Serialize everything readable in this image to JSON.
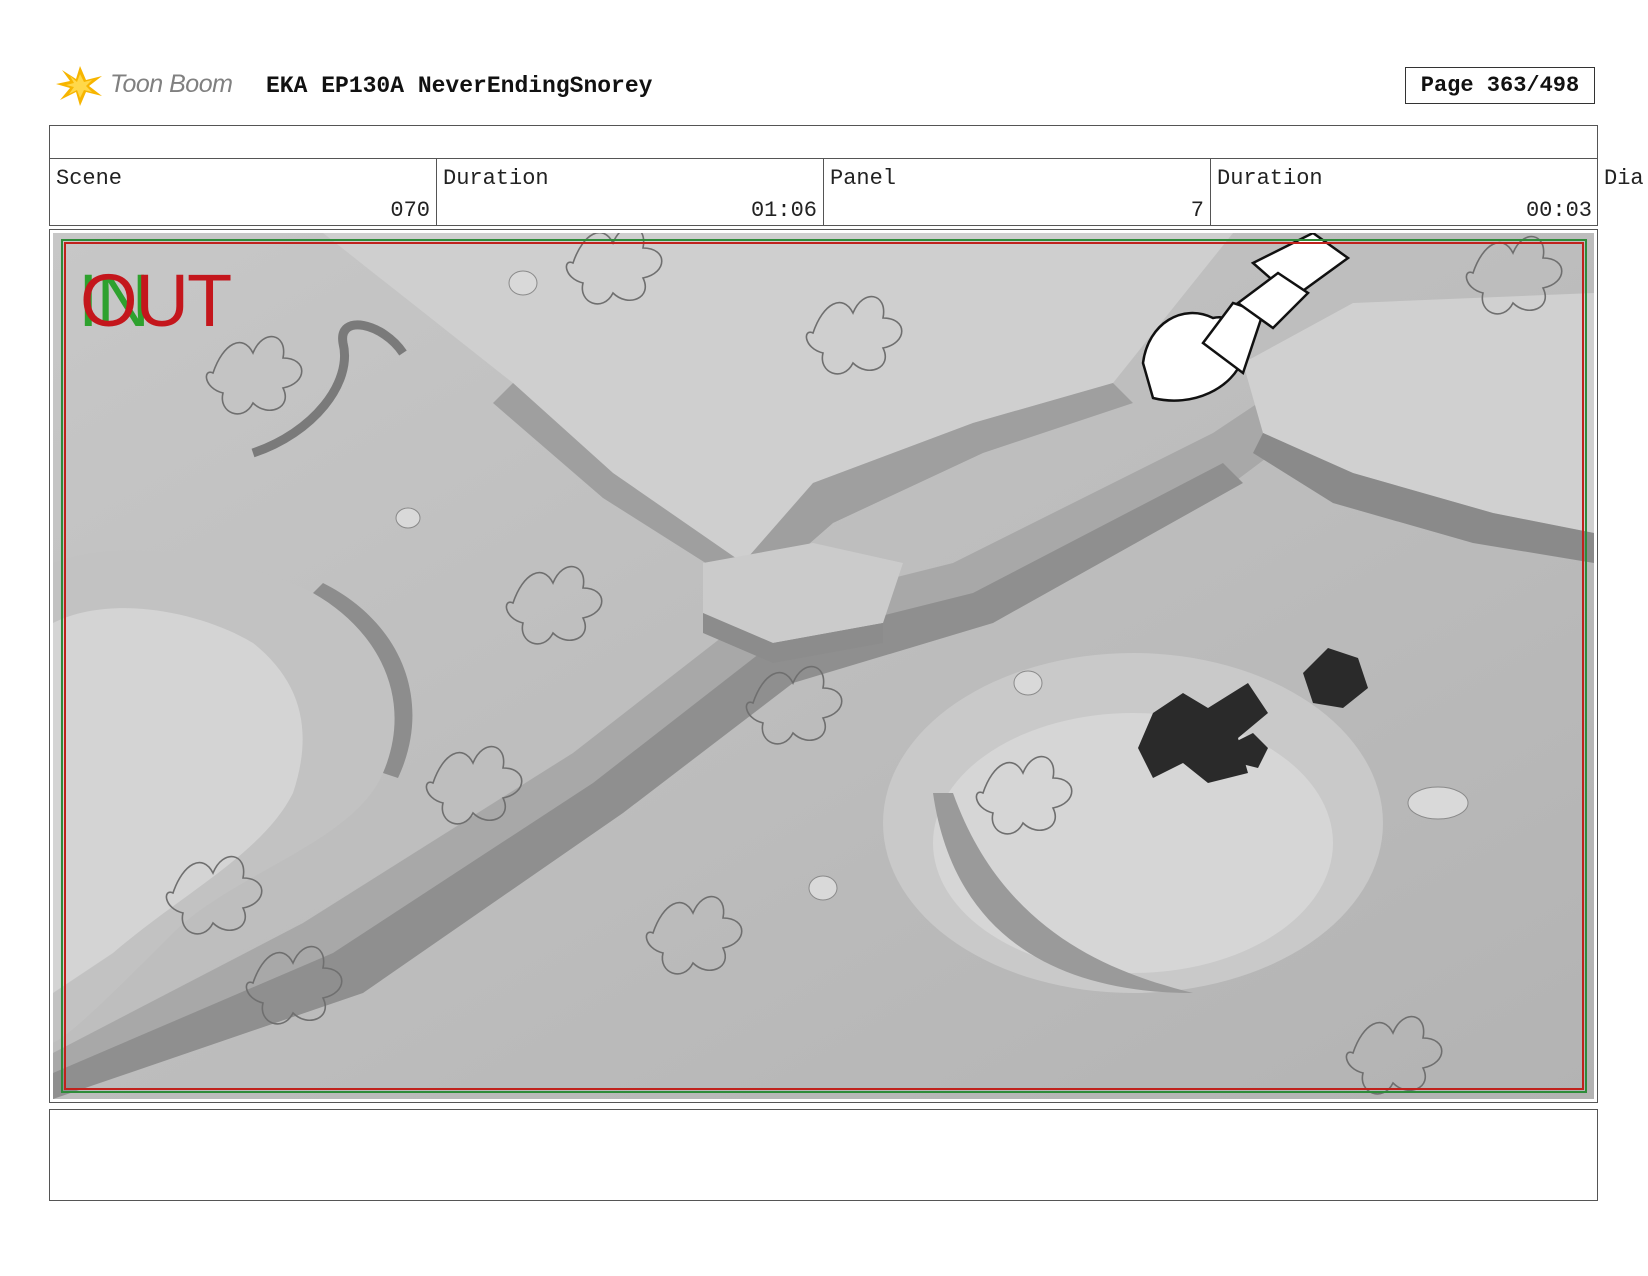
{
  "header": {
    "brand": "Toon Boom",
    "title": "EKA EP130A NeverEndingSnorey",
    "page": "Page 363/498"
  },
  "info": {
    "scene_label": "Scene",
    "scene_value": "070",
    "scene_duration_label": "Duration",
    "scene_duration_value": "01:06",
    "panel_label": "Panel",
    "panel_value": "7",
    "panel_duration_label": "Duration",
    "panel_duration_value": "00:03",
    "overflow_label": "Dia"
  },
  "panel": {
    "in_marker": "IN",
    "out_marker": "OUT"
  },
  "icons": {
    "logo": "toon-boom-starburst-icon"
  },
  "colors": {
    "logo_star": "#f7b500",
    "in_marker": "#2ea12e",
    "out_marker": "#c4161c",
    "frame_border": "#555555"
  }
}
